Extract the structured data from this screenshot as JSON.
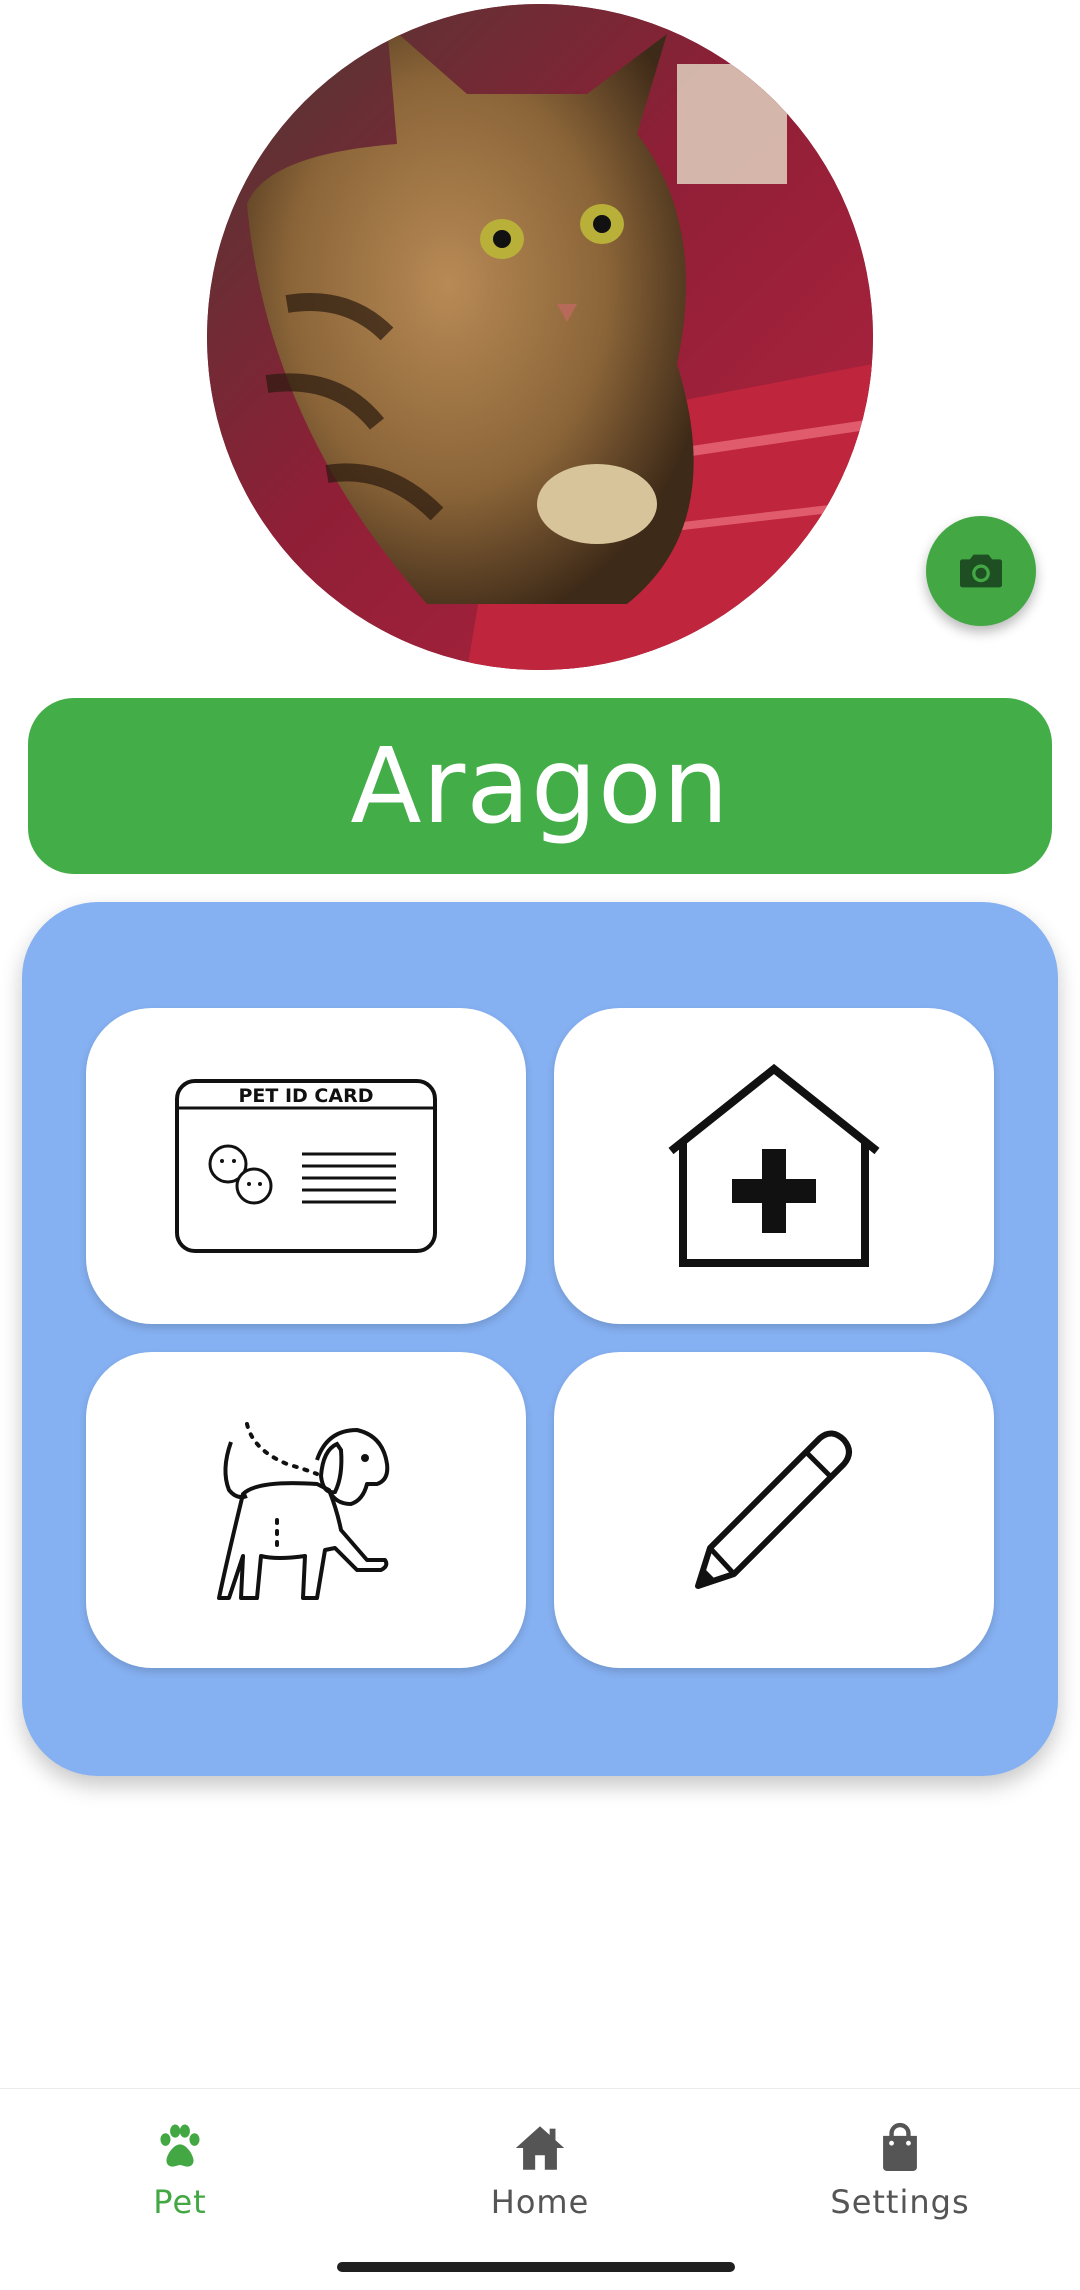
{
  "pet": {
    "name": "Aragon",
    "photo_icon": "cat-photo"
  },
  "actions": {
    "camera_icon": "camera-icon",
    "tiles": [
      {
        "icon": "pet-id-card-icon",
        "text": "PET ID CARD"
      },
      {
        "icon": "vet-clinic-icon"
      },
      {
        "icon": "dog-walk-icon"
      },
      {
        "icon": "pencil-edit-icon"
      }
    ]
  },
  "nav": {
    "pet_label": "Pet",
    "home_label": "Home",
    "settings_label": "Settings",
    "active": "Pet",
    "active_color": "#43a844",
    "inactive_color": "#555555"
  },
  "colors": {
    "accent": "#43ad48",
    "panel": "#85b0f1"
  }
}
